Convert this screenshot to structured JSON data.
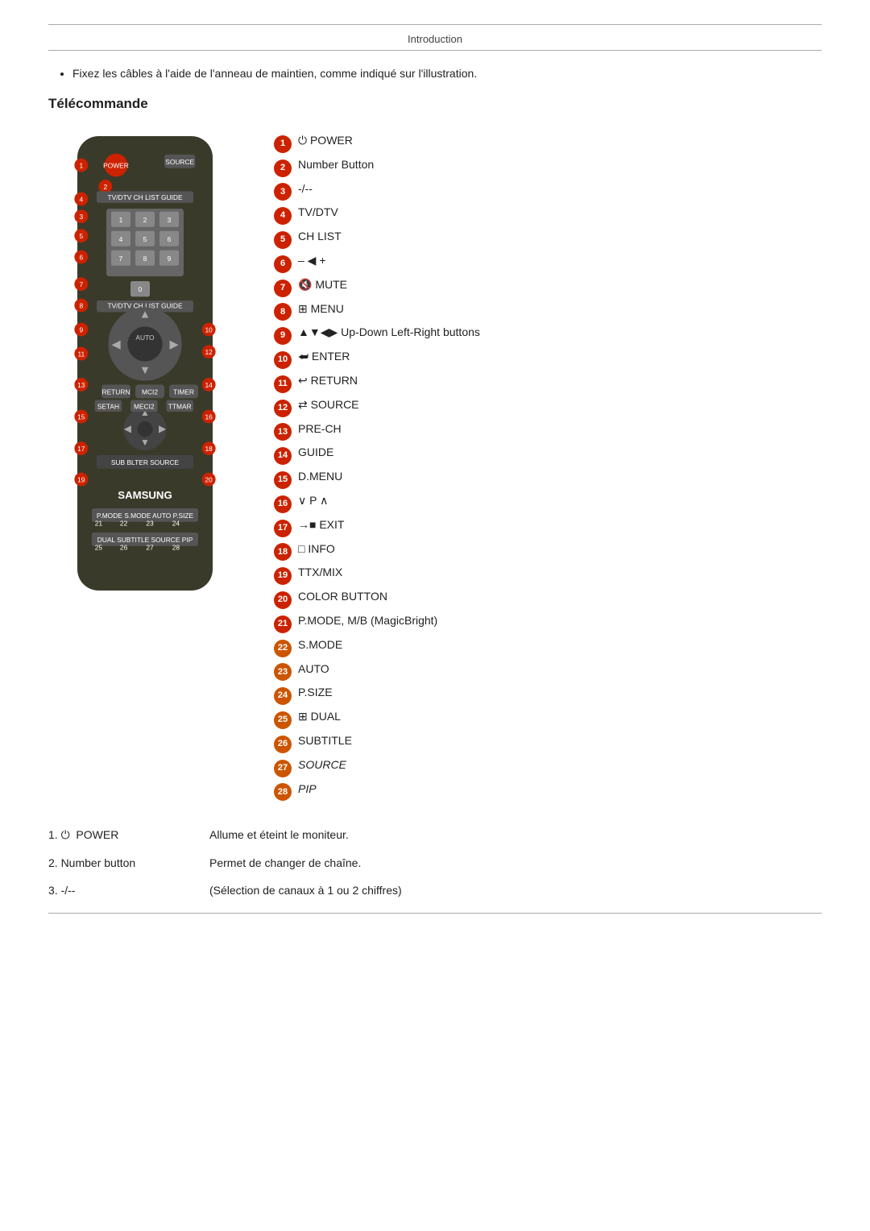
{
  "header": {
    "title": "Introduction"
  },
  "bullet": {
    "text": "Fixez les câbles à l'aide de l'anneau de maintien, comme indiqué sur l'illustration."
  },
  "section": {
    "title": "Télécommande"
  },
  "legend": [
    {
      "num": "1",
      "icon": "⏻",
      "text": "POWER",
      "color": "red"
    },
    {
      "num": "2",
      "icon": "",
      "text": "Number Button",
      "color": "red"
    },
    {
      "num": "3",
      "icon": "",
      "text": "-/--",
      "color": "red"
    },
    {
      "num": "4",
      "icon": "",
      "text": "TV/DTV",
      "color": "red"
    },
    {
      "num": "5",
      "icon": "",
      "text": "CH LIST",
      "color": "red"
    },
    {
      "num": "6",
      "icon": "– ◀ +",
      "text": "",
      "color": "red"
    },
    {
      "num": "7",
      "icon": "🔇",
      "text": "MUTE",
      "color": "red"
    },
    {
      "num": "8",
      "icon": "⊞",
      "text": "MENU",
      "color": "red"
    },
    {
      "num": "9",
      "icon": "▲▼◀▶",
      "text": "Up-Down Left-Right buttons",
      "color": "red"
    },
    {
      "num": "10",
      "icon": "↵",
      "text": "ENTER",
      "color": "red"
    },
    {
      "num": "11",
      "icon": "↩",
      "text": "RETURN",
      "color": "red"
    },
    {
      "num": "12",
      "icon": "⇄",
      "text": "SOURCE",
      "color": "red"
    },
    {
      "num": "13",
      "icon": "",
      "text": "PRE-CH",
      "color": "red"
    },
    {
      "num": "14",
      "icon": "",
      "text": "GUIDE",
      "color": "red"
    },
    {
      "num": "15",
      "icon": "",
      "text": "D.MENU",
      "color": "red"
    },
    {
      "num": "16",
      "icon": "∨ P ∧",
      "text": "",
      "color": "red"
    },
    {
      "num": "17",
      "icon": "→▪",
      "text": "EXIT",
      "color": "red"
    },
    {
      "num": "18",
      "icon": "□",
      "text": "INFO",
      "color": "red"
    },
    {
      "num": "19",
      "icon": "",
      "text": "TTX/MIX",
      "color": "red"
    },
    {
      "num": "20",
      "icon": "",
      "text": "COLOR BUTTON",
      "color": "red"
    },
    {
      "num": "21",
      "icon": "",
      "text": "P.MODE, M/B (MagicBright)",
      "color": "red"
    },
    {
      "num": "22",
      "icon": "",
      "text": "S.MODE",
      "color": "orange"
    },
    {
      "num": "23",
      "icon": "",
      "text": "AUTO",
      "color": "orange"
    },
    {
      "num": "24",
      "icon": "",
      "text": "P.SIZE",
      "color": "orange"
    },
    {
      "num": "25",
      "icon": "⊞",
      "text": "DUAL",
      "color": "orange"
    },
    {
      "num": "26",
      "icon": "",
      "text": "SUBTITLE",
      "color": "orange"
    },
    {
      "num": "27",
      "icon": "",
      "text": "SOURCE",
      "italic": true,
      "color": "orange"
    },
    {
      "num": "28",
      "icon": "",
      "text": "PIP",
      "italic": true,
      "color": "orange"
    }
  ],
  "descriptions": [
    {
      "label": "1. ⏻  POWER",
      "value": "Allume et éteint le moniteur."
    },
    {
      "label": "2. Number button",
      "value": "Permet de changer de chaîne."
    },
    {
      "label": "3. -/--",
      "value": "(Sélection de canaux à 1 ou 2 chiffres)"
    }
  ]
}
